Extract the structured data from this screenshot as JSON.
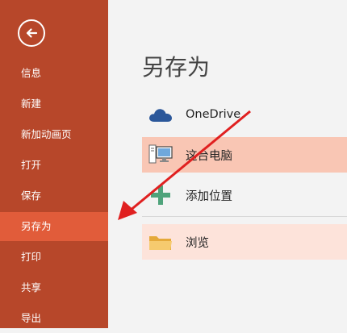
{
  "sidebar": {
    "items": [
      {
        "label": "信息"
      },
      {
        "label": "新建"
      },
      {
        "label": "新加动画页"
      },
      {
        "label": "打开"
      },
      {
        "label": "保存"
      },
      {
        "label": "另存为"
      },
      {
        "label": "打印"
      },
      {
        "label": "共享"
      },
      {
        "label": "导出"
      }
    ],
    "selected_index": 5
  },
  "main": {
    "title": "另存为",
    "locations": [
      {
        "label": "OneDrive",
        "icon": "cloud-icon"
      },
      {
        "label": "这台电脑",
        "icon": "computer-icon"
      },
      {
        "label": "添加位置",
        "icon": "plus-icon"
      },
      {
        "label": "浏览",
        "icon": "folder-icon"
      }
    ]
  },
  "colors": {
    "sidebar": "#b7472a",
    "selected": "#e15c3a",
    "highlight": "#f9c6b4",
    "soft": "#fde3da",
    "arrow": "#e02020",
    "cloud": "#2b579a",
    "plus": "#4fa37b",
    "folder": "#f0c060"
  },
  "annotation": {
    "type": "arrow",
    "color": "#e02020"
  }
}
